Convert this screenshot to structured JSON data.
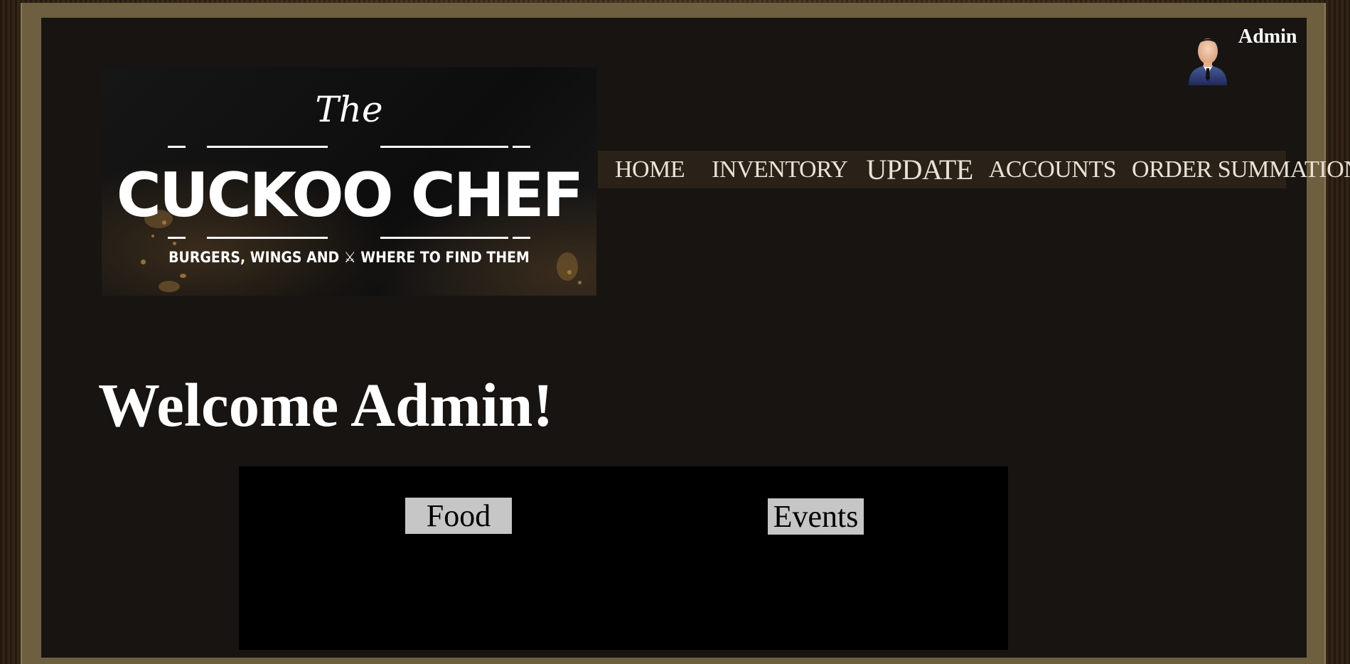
{
  "user": {
    "name": "Admin",
    "avatar_icon": "businessman-avatar-icon"
  },
  "logo": {
    "the": "The",
    "title": "CUCKOO CHEF",
    "tagline": "BURGERS, WINGS AND ⚔ WHERE TO FIND THEM"
  },
  "nav": {
    "items": [
      {
        "label": "HOME"
      },
      {
        "label": "INVENTORY"
      },
      {
        "label": "UPDATE"
      },
      {
        "label": "ACCOUNTS"
      },
      {
        "label": "ORDER SUMMATION"
      }
    ]
  },
  "main": {
    "welcome": "Welcome Admin!",
    "tabs": [
      {
        "label": "Food"
      },
      {
        "label": "Events"
      }
    ]
  },
  "colors": {
    "panel_background": "#171411",
    "frame": "#6e5f40",
    "nav_background": "#2a2219",
    "tab_button": "#c6c6c6",
    "accent_gold": "#b0813f"
  }
}
